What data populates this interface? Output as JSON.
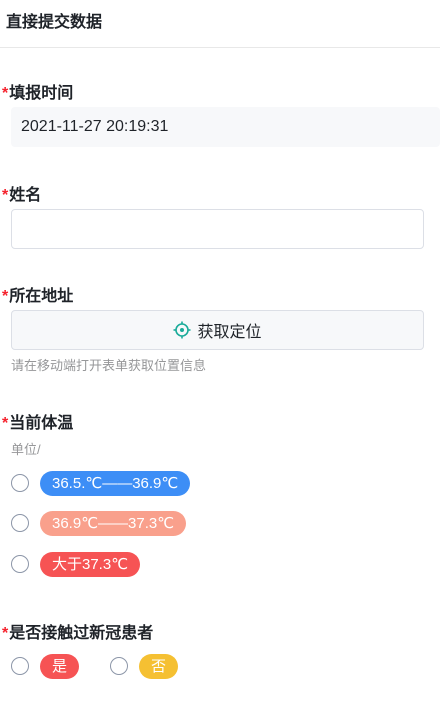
{
  "header": {
    "title": "直接提交数据"
  },
  "fields": {
    "time": {
      "label": "填报时间",
      "value": "2021-11-27 20:19:31"
    },
    "name": {
      "label": "姓名",
      "value": "",
      "placeholder": ""
    },
    "address": {
      "label": "所在地址",
      "button_label": "获取定位",
      "hint": "请在移动端打开表单获取位置信息"
    },
    "temperature": {
      "label": "当前体温",
      "unit": "单位/",
      "options": [
        {
          "label": "36.5.℃——36.9℃",
          "color": "#3d8ef6"
        },
        {
          "label": "36.9℃——37.3℃",
          "color": "#f9a08c"
        },
        {
          "label": "大于37.3℃",
          "color": "#f65354"
        }
      ]
    },
    "contact": {
      "label": "是否接触过新冠患者",
      "options": [
        {
          "label": "是",
          "color": "#f65354"
        },
        {
          "label": "否",
          "color": "#f5c032"
        }
      ]
    }
  },
  "required_mark": "*",
  "colors": {
    "required": "#f5222d",
    "locate_icon": "#1aab9a",
    "hint": "#969799"
  }
}
